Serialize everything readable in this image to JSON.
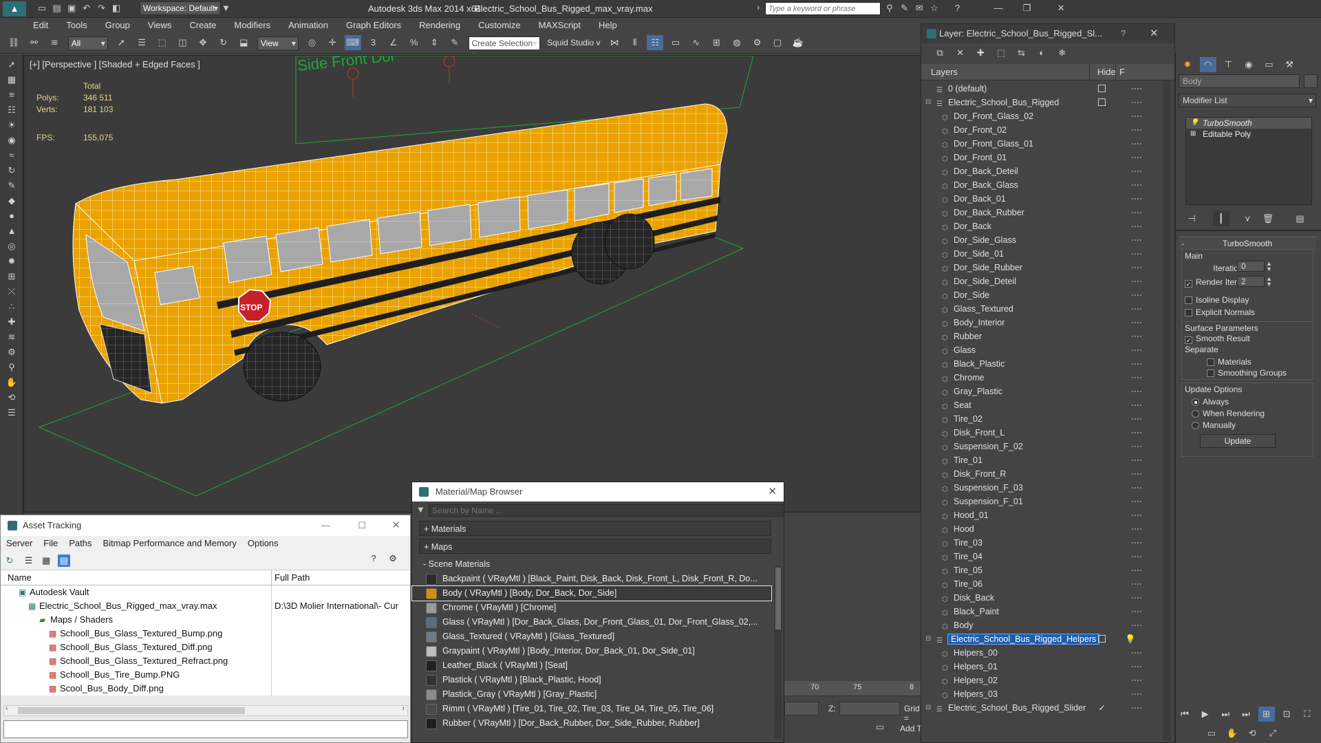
{
  "titlebar": {
    "workspace": "Workspace: Default",
    "app_title": "Autodesk 3ds Max  2014 x64",
    "file_title": "Electric_School_Bus_Rigged_max_vray.max",
    "search_placeholder": "Type a keyword or phrase"
  },
  "menu": [
    "Edit",
    "Tools",
    "Group",
    "Views",
    "Create",
    "Modifiers",
    "Animation",
    "Graph Editors",
    "Rendering",
    "Customize",
    "MAXScript",
    "Help"
  ],
  "toolbar": {
    "filter": "All",
    "view": "View",
    "selection_set": "Create Selection Se",
    "squid": "Squid Studio v"
  },
  "viewport": {
    "label": "[+] [Perspective ] [Shaded + Edged Faces ]",
    "stats_total": "Total",
    "polys_label": "Polys:",
    "polys": "346 511",
    "verts_label": "Verts:",
    "verts": "181 103",
    "fps_label": "FPS:",
    "fps": "155,075",
    "ref_text": "Side Front Dor",
    "stop_text": "STOP",
    "colors": {
      "body": "#e9a200",
      "wire": "#f4f4f4",
      "stripe": "#2a2a2a",
      "ground": "#1ea83a"
    }
  },
  "layers": {
    "title": "Layer: Electric_School_Bus_Rigged_Sl...",
    "col_layers": "Layers",
    "col_hide": "Hide",
    "col_f": "F",
    "rows": [
      {
        "name": "0 (default)",
        "indent": 1,
        "box": true
      },
      {
        "name": "Electric_School_Bus_Rigged",
        "indent": 1,
        "box": true,
        "expand": true
      },
      {
        "name": "Dor_Front_Glass_02",
        "indent": 2
      },
      {
        "name": "Dor_Front_02",
        "indent": 2
      },
      {
        "name": "Dor_Front_Glass_01",
        "indent": 2
      },
      {
        "name": "Dor_Front_01",
        "indent": 2
      },
      {
        "name": "Dor_Back_Deteil",
        "indent": 2
      },
      {
        "name": "Dor_Back_Glass",
        "indent": 2
      },
      {
        "name": "Dor_Back_01",
        "indent": 2
      },
      {
        "name": "Dor_Back_Rubber",
        "indent": 2
      },
      {
        "name": "Dor_Back",
        "indent": 2
      },
      {
        "name": "Dor_Side_Glass",
        "indent": 2
      },
      {
        "name": "Dor_Side_01",
        "indent": 2
      },
      {
        "name": "Dor_Side_Rubber",
        "indent": 2
      },
      {
        "name": "Dor_Side_Deteil",
        "indent": 2
      },
      {
        "name": "Dor_Side",
        "indent": 2
      },
      {
        "name": "Glass_Textured",
        "indent": 2
      },
      {
        "name": "Body_Interior",
        "indent": 2
      },
      {
        "name": "Rubber",
        "indent": 2
      },
      {
        "name": "Glass",
        "indent": 2
      },
      {
        "name": "Black_Plastic",
        "indent": 2
      },
      {
        "name": "Chrome",
        "indent": 2
      },
      {
        "name": "Gray_Plastic",
        "indent": 2
      },
      {
        "name": "Seat",
        "indent": 2
      },
      {
        "name": "Tire_02",
        "indent": 2
      },
      {
        "name": "Disk_Front_L",
        "indent": 2
      },
      {
        "name": "Suspension_F_02",
        "indent": 2
      },
      {
        "name": "Tire_01",
        "indent": 2
      },
      {
        "name": "Disk_Front_R",
        "indent": 2
      },
      {
        "name": "Suspension_F_03",
        "indent": 2
      },
      {
        "name": "Suspension_F_01",
        "indent": 2
      },
      {
        "name": "Hood_01",
        "indent": 2
      },
      {
        "name": "Hood",
        "indent": 2
      },
      {
        "name": "Tire_03",
        "indent": 2
      },
      {
        "name": "Tire_04",
        "indent": 2
      },
      {
        "name": "Tire_05",
        "indent": 2
      },
      {
        "name": "Tire_06",
        "indent": 2
      },
      {
        "name": "Disk_Back",
        "indent": 2
      },
      {
        "name": "Black_Paint",
        "indent": 2
      },
      {
        "name": "Body",
        "indent": 2
      },
      {
        "name": "Electric_School_Bus_Rigged_Helpers",
        "indent": 1,
        "box": true,
        "selected": true,
        "expand": true
      },
      {
        "name": "Helpers_00",
        "indent": 2
      },
      {
        "name": "Helpers_01",
        "indent": 2
      },
      {
        "name": "Helpers_02",
        "indent": 2
      },
      {
        "name": "Helpers_03",
        "indent": 2
      },
      {
        "name": "Electric_School_Bus_Rigged_Slider",
        "indent": 1,
        "check": true,
        "expand": true
      }
    ]
  },
  "command_panel": {
    "object_name": "Body",
    "modifier_list": "Modifier List",
    "stack": [
      "TurboSmooth",
      "Editable Poly"
    ],
    "rollout_title": "TurboSmooth",
    "main": "Main",
    "iterations_label": "Iterations:",
    "iterations": "0",
    "render_iters_label": "Render Iters:",
    "render_iters": "2",
    "isoline": "Isoline Display",
    "explicit_normals": "Explicit Normals",
    "surface_params": "Surface Parameters",
    "smooth_result": "Smooth Result",
    "separate": "Separate",
    "materials": "Materials",
    "smoothing_groups": "Smoothing Groups",
    "update_options": "Update Options",
    "always": "Always",
    "when_rendering": "When Rendering",
    "manually": "Manually",
    "update_button": "Update"
  },
  "asset_tracking": {
    "title": "Asset Tracking",
    "menu": [
      "Server",
      "File",
      "Paths",
      "Bitmap Performance and Memory",
      "Options"
    ],
    "col_name": "Name",
    "col_path": "Full Path",
    "rows": [
      {
        "name": "Autodesk Vault",
        "indent": 1,
        "path": ""
      },
      {
        "name": "Electric_School_Bus_Rigged_max_vray.max",
        "indent": 2,
        "path": "D:\\3D Molier International\\- Cur"
      },
      {
        "name": "Maps / Shaders",
        "indent": 3,
        "path": ""
      },
      {
        "name": "Schooll_Bus_Glass_Textured_Bump.png",
        "indent": 4,
        "path": ""
      },
      {
        "name": "Schooll_Bus_Glass_Textured_Diff.png",
        "indent": 4,
        "path": ""
      },
      {
        "name": "Schooll_Bus_Glass_Textured_Refract.png",
        "indent": 4,
        "path": ""
      },
      {
        "name": "Schooll_Bus_Tire_Bump.PNG",
        "indent": 4,
        "path": ""
      },
      {
        "name": "Scool_Bus_Body_Diff.png",
        "indent": 4,
        "path": ""
      }
    ]
  },
  "material_browser": {
    "title": "Material/Map Browser",
    "search_placeholder": "Search by Name ...",
    "cat_materials": "+ Materials",
    "cat_maps": "+ Maps",
    "cat_scene": "- Scene Materials",
    "rows": [
      {
        "text": "Backpaint  ( VRayMtl ) [Black_Paint, Disk_Back, Disk_Front_L, Disk_Front_R, Do...",
        "color": "#2b2b2b"
      },
      {
        "text": "Body  ( VRayMtl ) [Body, Dor_Back, Dor_Side]",
        "color": "#d88c10",
        "selected": true
      },
      {
        "text": "Chrome  ( VRayMtl ) [Chrome]",
        "color": "#9a9a9a"
      },
      {
        "text": "Glass  ( VRayMtl ) [Dor_Back_Glass, Dor_Front_Glass_01, Dor_Front_Glass_02,...",
        "color": "#5a6e80"
      },
      {
        "text": "Glass_Textured  ( VRayMtl ) [Glass_Textured]",
        "color": "#6e7c88"
      },
      {
        "text": "Graypaint  ( VRayMtl ) [Body_Interior, Dor_Back_01, Dor_Side_01]",
        "color": "#bdbdbd"
      },
      {
        "text": "Leather_Black  ( VRayMtl ) [Seat]",
        "color": "#222222"
      },
      {
        "text": "Plastick  ( VRayMtl ) [Black_Plastic, Hood]",
        "color": "#333333"
      },
      {
        "text": "Plastick_Gray  ( VRayMtl ) [Gray_Plastic]",
        "color": "#8a8a8a"
      },
      {
        "text": "Rimm  ( VRayMtl ) [Tire_01, Tire_02, Tire_03, Tire_04, Tire_05, Tire_06]",
        "color": "#4a4a4a"
      },
      {
        "text": "Rubber  ( VRayMtl ) [Dor_Back_Rubber, Dor_Side_Rubber, Rubber]",
        "color": "#1e1e1e"
      }
    ]
  },
  "timeline": {
    "ticks": [
      "70",
      "75",
      "8"
    ],
    "z_label": "Z:",
    "grid_label": "Grid =",
    "add_label": "Add T"
  }
}
